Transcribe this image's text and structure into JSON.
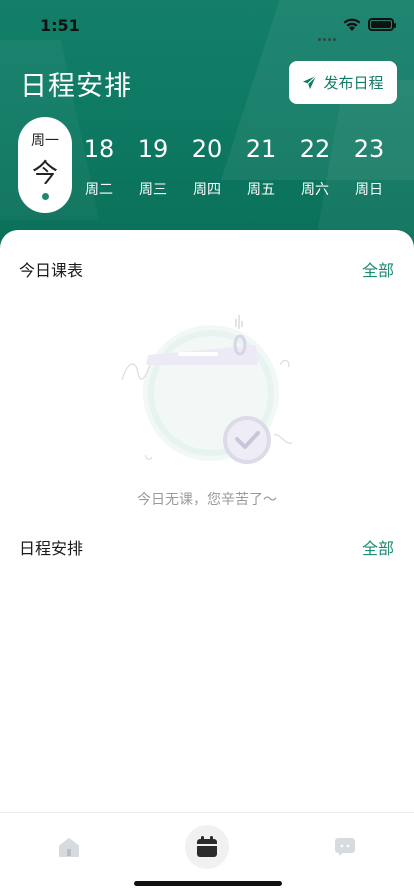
{
  "status_bar": {
    "time": "1:51"
  },
  "header": {
    "title": "日程安排",
    "publish_label": "发布日程"
  },
  "today": {
    "weekday": "周一",
    "label": "今"
  },
  "dates": [
    {
      "num": "18",
      "weekday": "周二"
    },
    {
      "num": "19",
      "weekday": "周三"
    },
    {
      "num": "20",
      "weekday": "周四"
    },
    {
      "num": "21",
      "weekday": "周五"
    },
    {
      "num": "22",
      "weekday": "周六"
    },
    {
      "num": "23",
      "weekday": "周日"
    }
  ],
  "courses": {
    "title": "今日课表",
    "more": "全部",
    "empty_text": "今日无课，您辛苦了～"
  },
  "schedule": {
    "title": "日程安排",
    "more": "全部"
  },
  "tabs": [
    {
      "icon": "home-icon",
      "active": false
    },
    {
      "icon": "calendar-icon",
      "active": true
    },
    {
      "icon": "chat-icon",
      "active": false
    }
  ],
  "colors": {
    "brand": "#137c66",
    "accent": "#1d8b73"
  }
}
